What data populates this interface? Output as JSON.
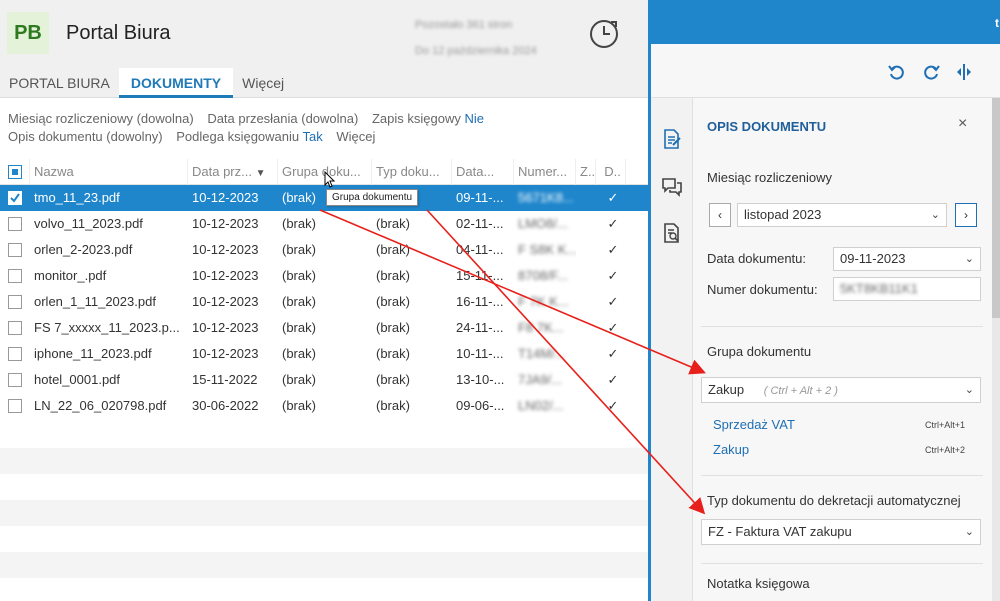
{
  "header": {
    "logo": "PB",
    "title": "Portal Biura",
    "info_line1": "Pozostało 361 stron",
    "info_line2": "Do 12 października 2024"
  },
  "tabs": [
    {
      "label": "PORTAL BIURA",
      "active": false
    },
    {
      "label": "DOKUMENTY",
      "active": true
    },
    {
      "label": "Więcej",
      "active": false
    }
  ],
  "filters": {
    "line1": [
      {
        "label": "Miesiąc rozliczeniowy (dowolna)",
        "value": ""
      },
      {
        "label": "Data przesłania (dowolna)",
        "value": ""
      },
      {
        "label": "Zapis księgowy",
        "value": "Nie"
      }
    ],
    "line2": [
      {
        "label": "Opis dokumentu (dowolny)",
        "value": ""
      },
      {
        "label": "Podlega księgowaniu",
        "value": "Tak"
      },
      {
        "label": "Więcej",
        "value": ""
      }
    ]
  },
  "table": {
    "columns": [
      "Nazwa",
      "Data prz...",
      "Grupa doku...",
      "Typ doku...",
      "Data...",
      "Numer...",
      "Z..",
      "D.."
    ],
    "rows": [
      {
        "name": "tmo_11_23.pdf",
        "date": "10-12-2023",
        "group": "(brak)",
        "type": "(brak)",
        "data": "09-11-...",
        "number": "5671K8...",
        "check": "✓",
        "selected": true
      },
      {
        "name": "volvo_11_2023.pdf",
        "date": "10-12-2023",
        "group": "(brak)",
        "type": "(brak)",
        "data": "02-11-...",
        "number": "LMO8/...",
        "check": "✓",
        "selected": false
      },
      {
        "name": "orlen_2-2023.pdf",
        "date": "10-12-2023",
        "group": "(brak)",
        "type": "(brak)",
        "data": "04-11-...",
        "number": "F S8K K...",
        "check": "✓",
        "selected": false
      },
      {
        "name": "monitor_.pdf",
        "date": "10-12-2023",
        "group": "(brak)",
        "type": "(brak)",
        "data": "15-11-...",
        "number": "8708/F...",
        "check": "✓",
        "selected": false
      },
      {
        "name": "orlen_1_11_2023.pdf",
        "date": "10-12-2023",
        "group": "(brak)",
        "type": "(brak)",
        "data": "16-11-...",
        "number": "F 7K K...",
        "check": "✓",
        "selected": false
      },
      {
        "name": "FS 7_xxxxx_11_2023.p...",
        "date": "10-12-2023",
        "group": "(brak)",
        "type": "(brak)",
        "data": "24-11-...",
        "number": "F8 7K...",
        "check": "✓",
        "selected": false
      },
      {
        "name": "iphone_11_2023.pdf",
        "date": "10-12-2023",
        "group": "(brak)",
        "type": "(brak)",
        "data": "10-11-...",
        "number": "T14M/...",
        "check": "✓",
        "selected": false
      },
      {
        "name": "hotel_0001.pdf",
        "date": "15-11-2022",
        "group": "(brak)",
        "type": "(brak)",
        "data": "13-10-...",
        "number": "7JA9/...",
        "check": "✓",
        "selected": false
      },
      {
        "name": "LN_22_06_020798.pdf",
        "date": "30-06-2022",
        "group": "(brak)",
        "type": "(brak)",
        "data": "09-06-...",
        "number": "LN02/...",
        "check": "✓",
        "selected": false
      }
    ]
  },
  "tooltip": "Grupa dokumentu",
  "right": {
    "top_title": "t",
    "panel_title": "OPIS DOKUMENTU",
    "close": "×",
    "month_label": "Miesiąc rozliczeniowy",
    "month_value": "listopad 2023",
    "prev": "‹",
    "next": "›",
    "doc_date_label": "Data dokumentu:",
    "doc_date_value": "09-11-2023",
    "doc_number_label": "Numer dokumentu:",
    "doc_number_value": "5KT8KB11K1",
    "group_label": "Grupa dokumentu",
    "group_value": "Zakup",
    "group_hint": "( Ctrl + Alt + 2 )",
    "options": [
      {
        "label": "Sprzedaż VAT",
        "shortcut": "Ctrl+Alt+1"
      },
      {
        "label": "Zakup",
        "shortcut": "Ctrl+Alt+2"
      }
    ],
    "type_label": "Typ dokumentu do dekretacji automatycznej",
    "type_value": "FZ - Faktura VAT zakupu",
    "note_label": "Notatka księgowa"
  },
  "colors": {
    "accent": "#1f86cc",
    "link": "#1f6fb5",
    "arrow": "#e8201b"
  }
}
